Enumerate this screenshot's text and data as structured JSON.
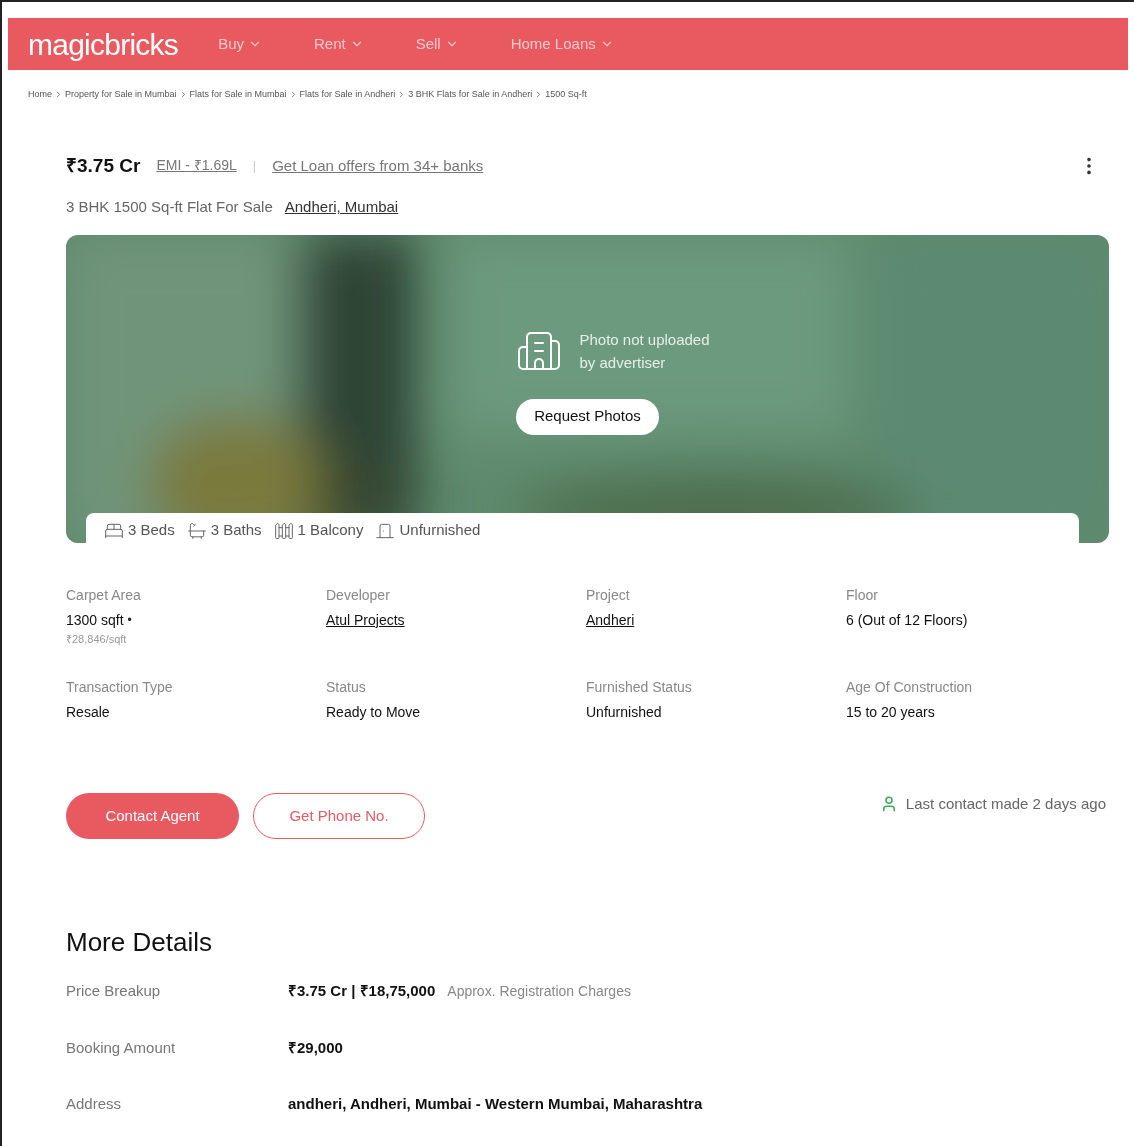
{
  "header": {
    "logo": "magicbricks",
    "nav": [
      {
        "label": "Buy"
      },
      {
        "label": "Rent"
      },
      {
        "label": "Sell"
      },
      {
        "label": "Home Loans"
      }
    ]
  },
  "breadcrumbs": [
    "Home",
    "Property for Sale in Mumbai",
    "Flats for Sale in Mumbai",
    "Flats for Sale in Andheri",
    "3 BHK Flats for Sale in Andheri",
    "1500 Sq-ft"
  ],
  "listing": {
    "price": "₹3.75 Cr",
    "emi": "EMI - ₹1.69L",
    "separator": "|",
    "loan_offer": "Get Loan offers from 34+ banks",
    "title": "3 BHK 1500 Sq-ft Flat For Sale",
    "location": "Andheri, Mumbai"
  },
  "photo": {
    "kind": "picture",
    "message_line_1": "Photo not uploaded",
    "message_line_2": "by advertiser",
    "button": "Request Photos"
  },
  "amenities": [
    {
      "kind": "bed",
      "label": "3 Beds"
    },
    {
      "kind": "bath",
      "label": "3 Baths"
    },
    {
      "kind": "balcony",
      "label": "1 Balcony"
    },
    {
      "kind": "furnishing",
      "label": "Unfurnished"
    }
  ],
  "attributes": [
    {
      "label": "Carpet Area",
      "value": "1300 sqft",
      "kind": "text",
      "suffix": "•",
      "sub": "₹28,846/sqft"
    },
    {
      "label": "Developer",
      "value": "Atul Projects",
      "kind": "link"
    },
    {
      "label": "Project",
      "value": "Andheri",
      "kind": "link"
    },
    {
      "label": "Floor",
      "value": "6 (Out of 12 Floors)",
      "kind": "text"
    },
    {
      "label": "Transaction Type",
      "value": "Resale",
      "kind": "text"
    },
    {
      "label": "Status",
      "value": "Ready to Move",
      "kind": "text"
    },
    {
      "label": "Furnished Status",
      "value": "Unfurnished",
      "kind": "text"
    },
    {
      "label": "Age Of Construction",
      "value": "15 to 20 years",
      "kind": "text"
    }
  ],
  "actions": {
    "primary": "Contact Agent",
    "secondary": "Get Phone No.",
    "last_contact": "Last contact made 2 days ago"
  },
  "more_details": {
    "title": "More Details",
    "rows": [
      {
        "label": "Price Breakup",
        "value": "₹3.75 Cr | ₹18,75,000",
        "note": "Approx. Registration Charges"
      },
      {
        "label": "Booking Amount",
        "value": "₹29,000"
      },
      {
        "label": "Address",
        "value": "andheri, Andheri, Mumbai - Western Mumbai, Maharashtra"
      }
    ]
  }
}
